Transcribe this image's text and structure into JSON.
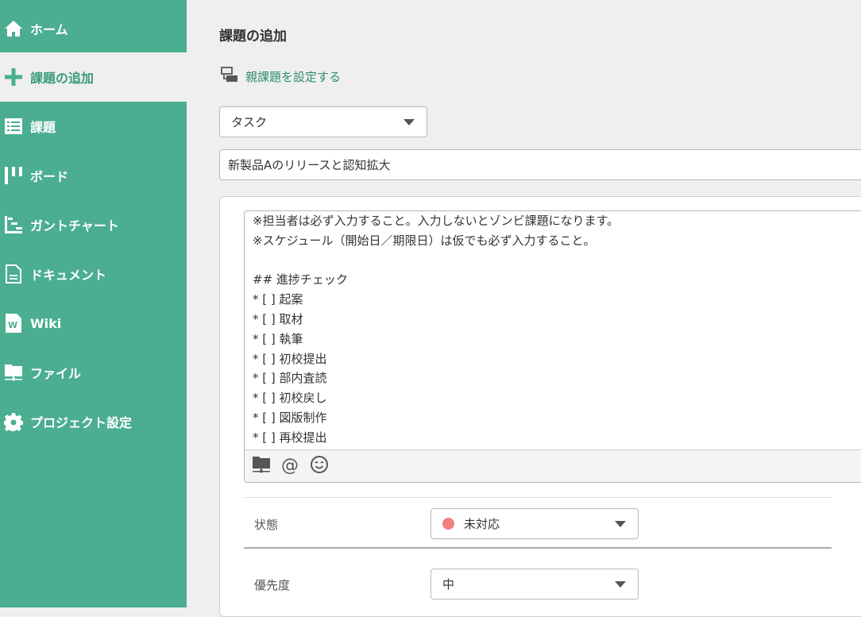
{
  "sidebar": {
    "items": [
      {
        "label": "ホーム",
        "icon": "home-icon"
      },
      {
        "label": "課題の追加",
        "icon": "plus-icon",
        "active": true
      },
      {
        "label": "課題",
        "icon": "list-icon"
      },
      {
        "label": "ボード",
        "icon": "board-icon"
      },
      {
        "label": "ガントチャート",
        "icon": "gantt-icon"
      },
      {
        "label": "ドキュメント",
        "icon": "document-icon"
      },
      {
        "label": "Wiki",
        "icon": "wiki-icon"
      },
      {
        "label": "ファイル",
        "icon": "file-icon"
      },
      {
        "label": "プロジェクト設定",
        "icon": "gear-icon"
      }
    ]
  },
  "main": {
    "title": "課題の追加",
    "parent_link": "親課題を設定する",
    "issue_type": "タスク",
    "summary": "新製品Aのリリースと認知拡大",
    "description_lines": [
      "※担当者は必ず入力すること。入力しないとゾンビ課題になります。",
      "※スケジュール（開始日／期限日）は仮でも必ず入力すること。",
      "",
      "## 進捗チェック",
      "* [ ] 起案",
      "* [ ] 取材",
      "* [ ] 執筆",
      "* [ ] 初校提出",
      "* [ ] 部内査読",
      "* [ ] 初校戻し",
      "* [ ] 図版制作",
      "* [ ] 再校提出"
    ],
    "fields": {
      "status_label": "状態",
      "status_value": "未対応",
      "status_color": "#f08080",
      "priority_label": "優先度",
      "priority_value": "中"
    }
  },
  "colors": {
    "sidebar": "#4bae91",
    "accent": "#2d8c6f"
  }
}
